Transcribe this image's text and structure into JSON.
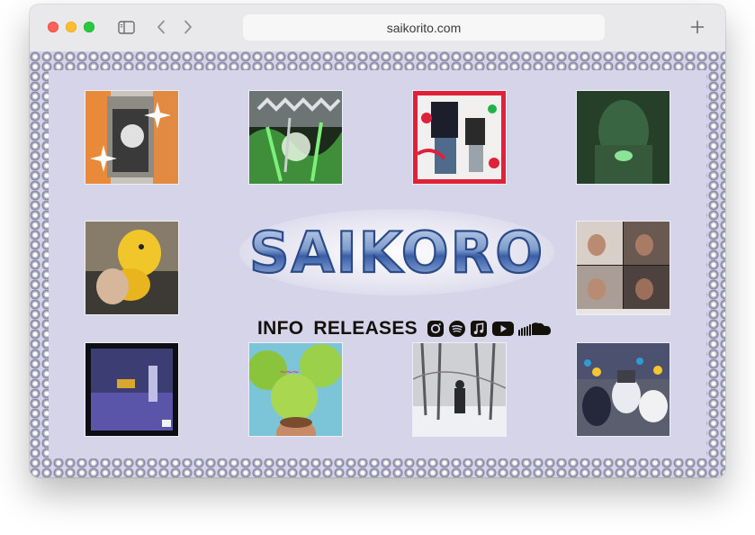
{
  "browser": {
    "address": "saikorito.com",
    "controls": {
      "close": "close-window",
      "minimize": "minimize-window",
      "zoom": "zoom-window",
      "sidebar_icon": "sidebar-icon",
      "back_icon": "chevron-left-icon",
      "forward_icon": "chevron-right-icon",
      "new_tab_icon": "plus-icon"
    }
  },
  "site": {
    "logo_text": "SAIKORO",
    "nav": {
      "info": "INFO",
      "releases": "RELEASES"
    },
    "social_icons": [
      "instagram-icon",
      "spotify-icon",
      "apple-music-icon",
      "youtube-icon",
      "soundcloud-icon"
    ],
    "covers": [
      {
        "name": "cover-train-sparkle"
      },
      {
        "name": "cover-green-chrome-group"
      },
      {
        "name": "cover-red-collage"
      },
      {
        "name": "cover-green-night"
      },
      {
        "name": "cover-yellow-plush"
      },
      {
        "name": "cover-four-panel-portrait"
      },
      {
        "name": "cover-night-street"
      },
      {
        "name": "cover-flower-face"
      },
      {
        "name": "cover-snowy-woods"
      },
      {
        "name": "cover-plush-creatures"
      }
    ]
  },
  "colors": {
    "page_background": "#d5d4e9",
    "text": "#14110a",
    "logo_blue": "#3a5ea8"
  }
}
